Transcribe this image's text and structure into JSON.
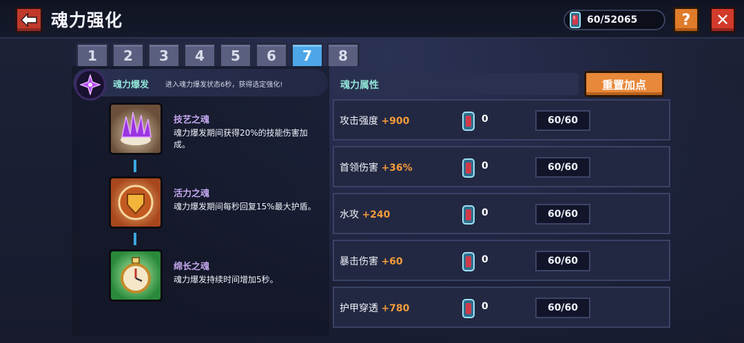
{
  "header": {
    "title": "魂力强化",
    "currency_value": "60/52065",
    "help_label": "?",
    "close_label": "✕"
  },
  "tabs": [
    {
      "label": "1",
      "active": false
    },
    {
      "label": "2",
      "active": false
    },
    {
      "label": "3",
      "active": false
    },
    {
      "label": "4",
      "active": false
    },
    {
      "label": "5",
      "active": false
    },
    {
      "label": "6",
      "active": false
    },
    {
      "label": "7",
      "active": true
    },
    {
      "label": "8",
      "active": false
    }
  ],
  "burst": {
    "title": "魂力爆发",
    "description": "进入魂力爆发状态6秒，获得选定强化!"
  },
  "skills": [
    {
      "name": "技艺之魂",
      "desc": "魂力爆发期间获得20%的技能伤害加成。",
      "icon": "purple-crystal-icon"
    },
    {
      "name": "活力之魂",
      "desc": "魂力爆发期间每秒回复15%最大护盾。",
      "icon": "shield-emblem-icon"
    },
    {
      "name": "绵长之魂",
      "desc": "魂力爆发持续时间增加5秒。",
      "icon": "stopwatch-icon"
    }
  ],
  "attributes": {
    "header": "魂力属性",
    "reset_label": "重置加点",
    "rows": [
      {
        "name": "攻击强度",
        "bonus": "+900",
        "count": "0",
        "level": "60/60"
      },
      {
        "name": "首领伤害",
        "bonus": "+36%",
        "count": "0",
        "level": "60/60"
      },
      {
        "name": "水攻",
        "bonus": "+240",
        "count": "0",
        "level": "60/60"
      },
      {
        "name": "暴击伤害",
        "bonus": "+60",
        "count": "0",
        "level": "60/60"
      },
      {
        "name": "护甲穿透",
        "bonus": "+780",
        "count": "0",
        "level": "60/60"
      }
    ]
  },
  "colors": {
    "accent_tab": "#4da6e8",
    "bonus": "#f39c3a",
    "reset_button": "#e8883a",
    "close_button": "#d23a2c"
  }
}
